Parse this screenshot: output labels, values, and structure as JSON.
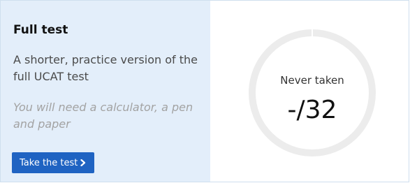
{
  "card": {
    "title": "Full test",
    "description": "A shorter, practice version of the full UCAT test",
    "requirement": "You will need a calculator, a pen and paper",
    "button_label": "Take the test",
    "button_icon": "chevron-right-icon"
  },
  "score": {
    "status": "Never taken",
    "value": "-/32"
  },
  "colors": {
    "panel_background": "#e3eefa",
    "button": "#1f63c2",
    "ring": "#ececec"
  }
}
